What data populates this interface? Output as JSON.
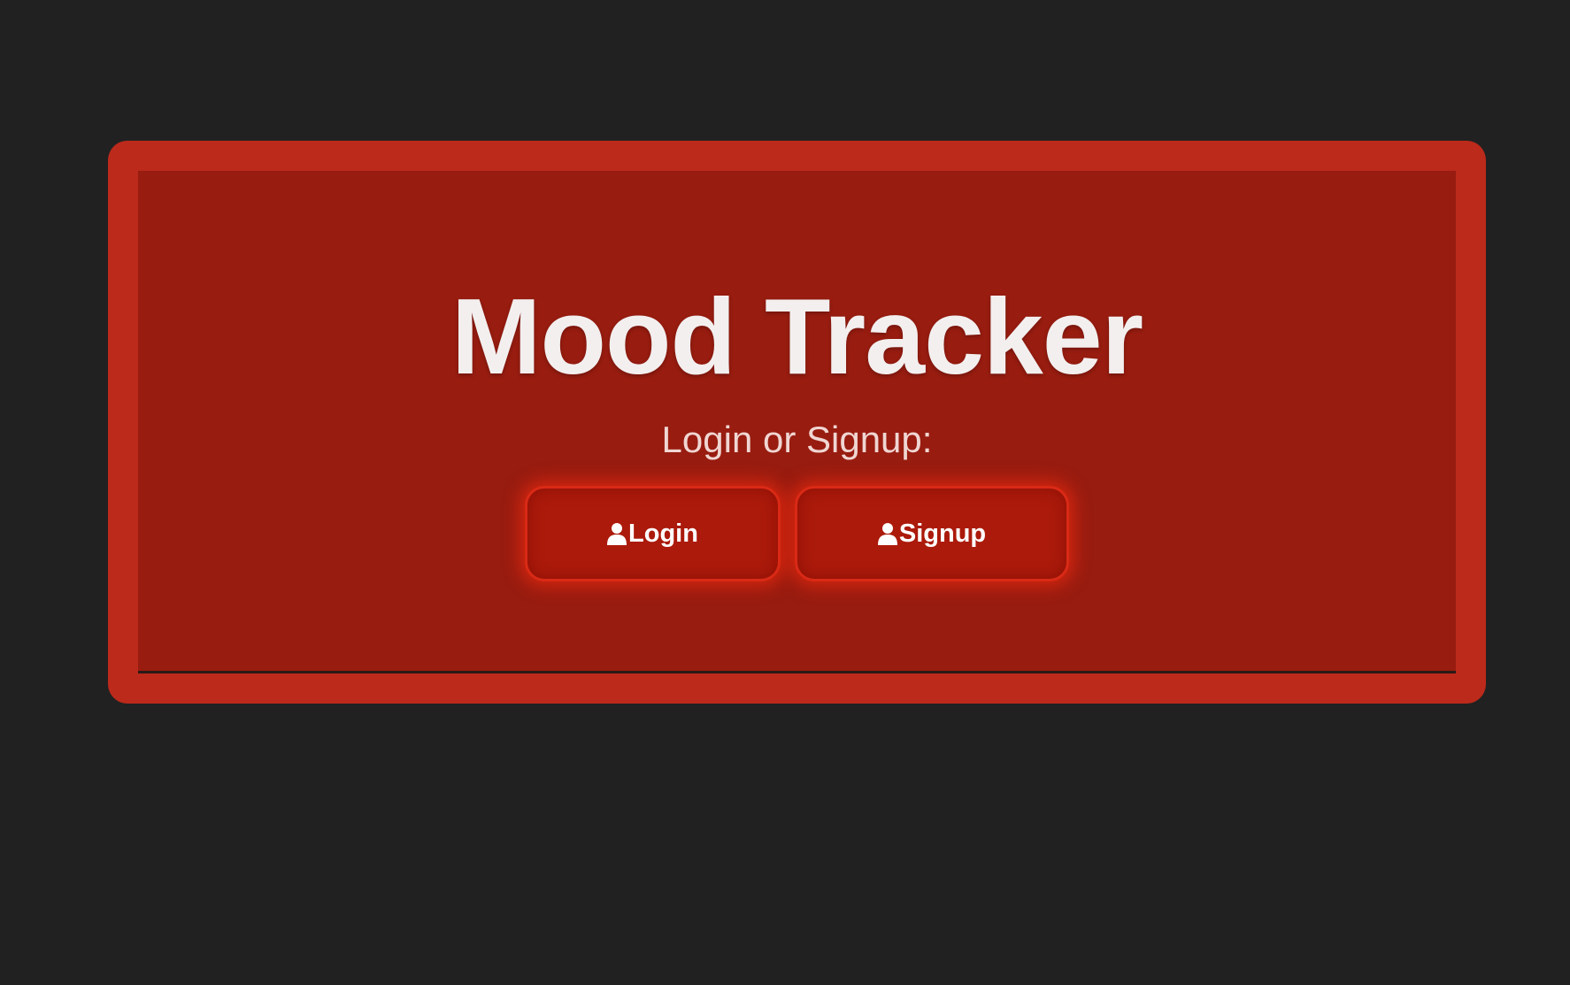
{
  "app": {
    "title": "Mood Tracker",
    "subtitle": "Login or Signup:"
  },
  "buttons": {
    "login": {
      "label": "Login",
      "icon": "user-icon"
    },
    "signup": {
      "label": "Signup",
      "icon": "user-icon"
    }
  },
  "colors": {
    "background": "#212121",
    "card_frame": "#bc2a1b",
    "card_inner": "#981c10",
    "button_fill": "#ab1a0b",
    "button_glow": "#e6280f",
    "text": "#f3efef"
  }
}
